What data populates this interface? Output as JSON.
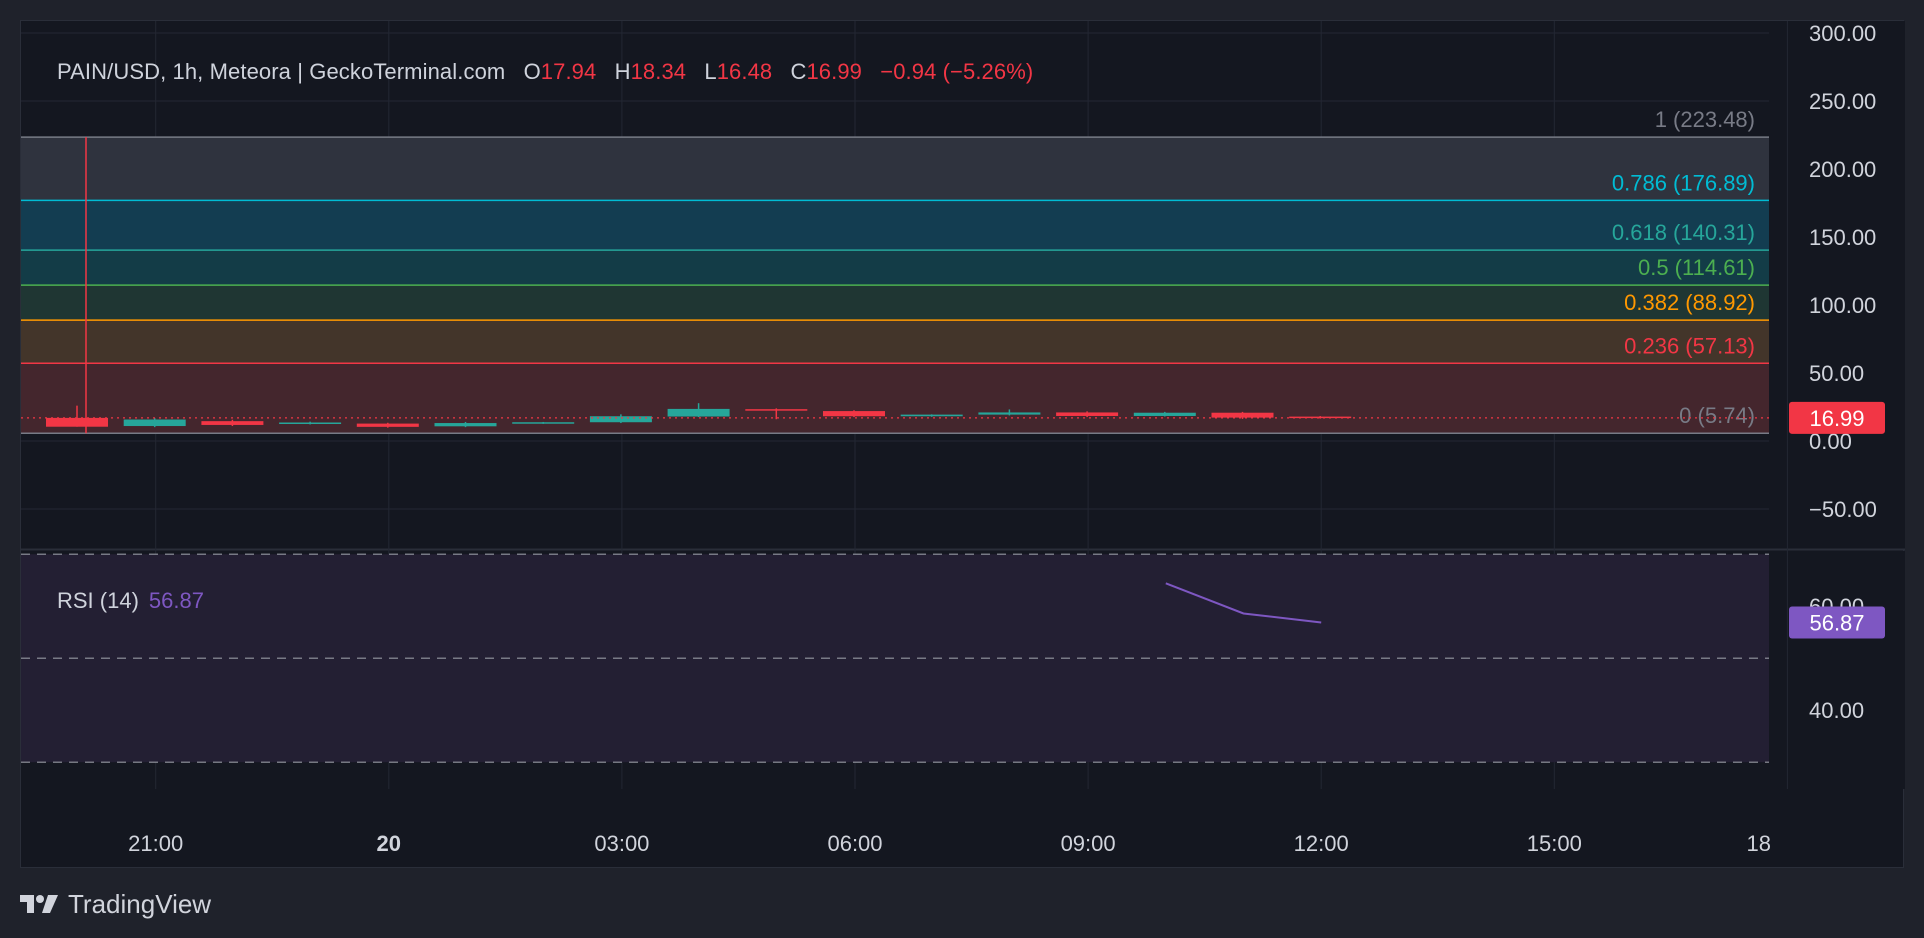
{
  "header": {
    "symbol": "PAIN/USD, 1h, Meteora | GeckoTerminal.com",
    "o_label": "O",
    "o_value": "17.94",
    "h_label": "H",
    "h_value": "18.34",
    "l_label": "L",
    "l_value": "16.48",
    "c_label": "C",
    "c_value": "16.99",
    "change": "−0.94 (−5.26%)"
  },
  "rsi_legend": {
    "label": "RSI (14)",
    "value": "56.87"
  },
  "footer": {
    "brand": "TradingView",
    "logo_icon": "tradingview-logo-icon"
  },
  "colors": {
    "up": "#26a69a",
    "down": "#f23645",
    "rsi": "#7e57c2",
    "fib_1": "#787b86",
    "fib_0786": "#00bcd4",
    "fib_0618": "#26a69a",
    "fib_05": "#4caf50",
    "fib_0382": "#ff9800",
    "fib_0236": "#f23645",
    "fib_0": "#787b86"
  },
  "chart_data": [
    {
      "type": "candlestick",
      "title": "PAIN/USD, 1h, Meteora | GeckoTerminal.com",
      "x_ticks": [
        {
          "value": 1,
          "label": "21:00",
          "bold": false
        },
        {
          "value": 4,
          "label": "20",
          "bold": true
        },
        {
          "value": 7,
          "label": "03:00",
          "bold": false
        },
        {
          "value": 10,
          "label": "06:00",
          "bold": false
        },
        {
          "value": 13,
          "label": "09:00",
          "bold": false
        },
        {
          "value": 16,
          "label": "12:00",
          "bold": false
        },
        {
          "value": 19,
          "label": "15:00",
          "bold": false
        },
        {
          "value": 22,
          "label": "18",
          "bold": false
        }
      ],
      "y_ticks": [
        "300.00",
        "250.00",
        "200.00",
        "150.00",
        "100.00",
        "50.00",
        "0.00",
        "−50.00"
      ],
      "ylim": [
        -65,
        310
      ],
      "xlim": [
        -0.6,
        22.15
      ],
      "last_price": "16.99",
      "last_price_value": 16.99,
      "candles": [
        {
          "t": 0,
          "o": 17.0,
          "h": 26.0,
          "l": 10.5,
          "c": 10.5
        },
        {
          "t": 1,
          "o": 11.0,
          "h": 16.8,
          "l": 10.2,
          "c": 15.8
        },
        {
          "t": 2,
          "o": 14.6,
          "h": 15.6,
          "l": 11.0,
          "c": 11.8
        },
        {
          "t": 3,
          "o": 13.0,
          "h": 14.2,
          "l": 12.2,
          "c": 13.6
        },
        {
          "t": 4,
          "o": 12.8,
          "h": 13.4,
          "l": 9.8,
          "c": 10.4
        },
        {
          "t": 5,
          "o": 10.8,
          "h": 14.0,
          "l": 10.2,
          "c": 13.2
        },
        {
          "t": 6,
          "o": 13.2,
          "h": 14.0,
          "l": 12.6,
          "c": 13.8
        },
        {
          "t": 7,
          "o": 13.8,
          "h": 19.6,
          "l": 13.2,
          "c": 18.2
        },
        {
          "t": 8,
          "o": 18.0,
          "h": 27.8,
          "l": 17.6,
          "c": 23.6
        },
        {
          "t": 9,
          "o": 23.4,
          "h": 24.0,
          "l": 16.0,
          "c": 22.4
        },
        {
          "t": 10,
          "o": 22.0,
          "h": 22.6,
          "l": 17.6,
          "c": 18.2
        },
        {
          "t": 11,
          "o": 18.2,
          "h": 19.6,
          "l": 17.8,
          "c": 19.4
        },
        {
          "t": 12,
          "o": 19.4,
          "h": 23.2,
          "l": 18.8,
          "c": 21.0
        },
        {
          "t": 13,
          "o": 21.0,
          "h": 21.8,
          "l": 17.6,
          "c": 18.4
        },
        {
          "t": 14,
          "o": 18.4,
          "h": 21.4,
          "l": 18.0,
          "c": 20.8
        },
        {
          "t": 15,
          "o": 20.8,
          "h": 21.4,
          "l": 16.2,
          "c": 17.2
        },
        {
          "t": 16,
          "o": 17.94,
          "h": 18.34,
          "l": 16.48,
          "c": 16.99
        }
      ],
      "fib_levels": [
        {
          "level": "1",
          "value": 223.48,
          "label": "1 (223.48)",
          "color": "#787b86",
          "fill": "#2f333e"
        },
        {
          "level": "0.786",
          "value": 176.89,
          "label": "0.786 (176.89)",
          "color": "#00bcd4",
          "fill": "#133d51"
        },
        {
          "level": "0.618",
          "value": 140.31,
          "label": "0.618 (140.31)",
          "color": "#26a69a",
          "fill": "#133c47"
        },
        {
          "level": "0.5",
          "value": 114.61,
          "label": "0.5 (114.61)",
          "color": "#4caf50",
          "fill": "#1f3633"
        },
        {
          "level": "0.382",
          "value": 88.92,
          "label": "0.382 (88.92)",
          "color": "#ff9800",
          "fill": "#43352a"
        },
        {
          "level": "0.236",
          "value": 57.13,
          "label": "0.236 (57.13)",
          "color": "#f23645",
          "fill": "#44262d"
        },
        {
          "level": "0",
          "value": 5.74,
          "label": "0 (5.74)",
          "color": "#787b86",
          "fill": null
        }
      ],
      "grid": true
    },
    {
      "type": "line",
      "title": "RSI (14)",
      "y_ticks": [
        "60.00",
        "40.00"
      ],
      "ylim": [
        24.8,
        75.0
      ],
      "band_levels": [
        70,
        50,
        30
      ],
      "last_value": "56.87",
      "last_value_num": 56.87,
      "points": [
        {
          "t": 14,
          "v": 64.4
        },
        {
          "t": 15,
          "v": 58.6
        },
        {
          "t": 16,
          "v": 56.87
        }
      ]
    }
  ]
}
